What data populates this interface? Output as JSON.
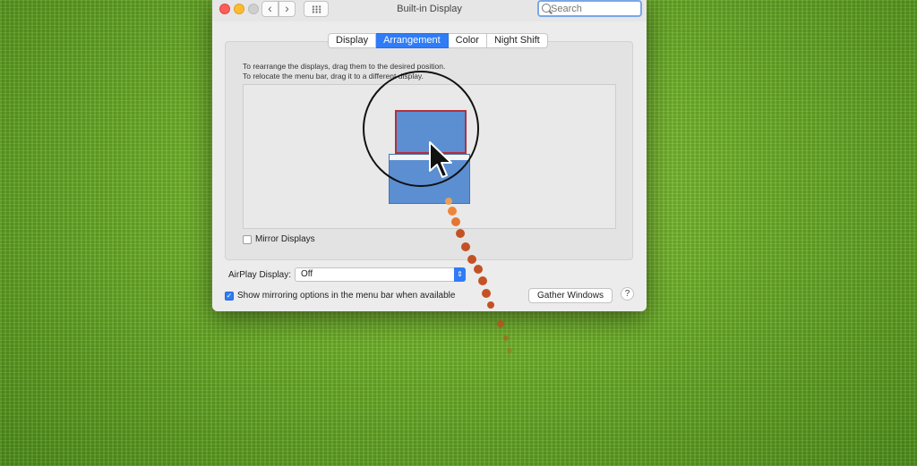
{
  "window": {
    "title": "Built-in Display",
    "search_placeholder": "Search"
  },
  "tabs": [
    {
      "label": "Display",
      "active": false
    },
    {
      "label": "Arrangement",
      "active": true
    },
    {
      "label": "Color",
      "active": false
    },
    {
      "label": "Night Shift",
      "active": false
    }
  ],
  "arrangement": {
    "instruction_line1": "To rearrange the displays, drag them to the desired position.",
    "instruction_line2": "To relocate the menu bar, drag it to a different display."
  },
  "mirror_displays": {
    "label": "Mirror Displays",
    "checked": false
  },
  "airplay": {
    "label": "AirPlay Display:",
    "value": "Off"
  },
  "show_mirroring": {
    "label": "Show mirroring options in the menu bar when available",
    "checked": true
  },
  "buttons": {
    "gather_windows": "Gather Windows",
    "help": "?"
  },
  "colors": {
    "accent": "#2f7cf6",
    "display_fill": "#5b8fd2",
    "selected_border": "#b2313f"
  }
}
